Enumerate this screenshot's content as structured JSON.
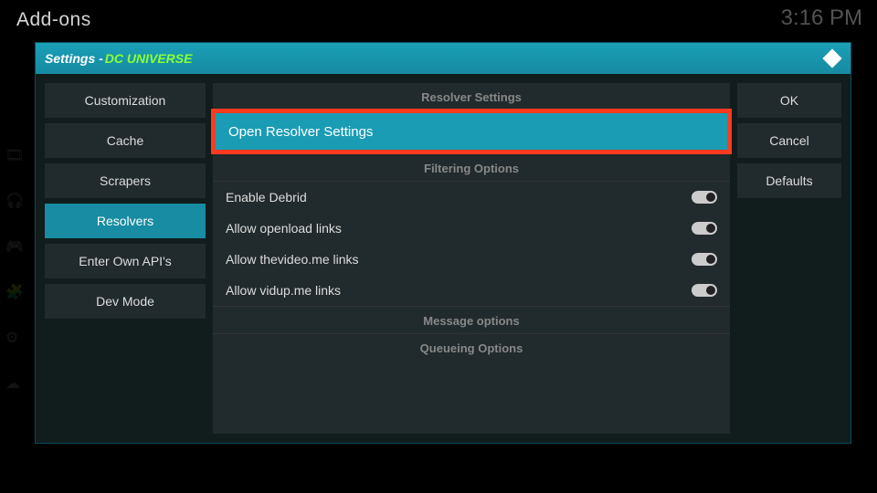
{
  "topbar": {
    "title": "Add-ons",
    "clock": "3:16 PM"
  },
  "dialog": {
    "prefix": "Settings - ",
    "addon_name": "DC UNIVERSE"
  },
  "nav": {
    "items": [
      {
        "label": "Customization"
      },
      {
        "label": "Cache"
      },
      {
        "label": "Scrapers"
      },
      {
        "label": "Resolvers",
        "active": true
      },
      {
        "label": "Enter Own API's"
      },
      {
        "label": "Dev Mode"
      }
    ]
  },
  "sections": {
    "resolver_header": "Resolver Settings",
    "open_resolver": "Open Resolver Settings",
    "filtering_header": "Filtering Options",
    "toggles": [
      {
        "label": "Enable Debrid",
        "on": true
      },
      {
        "label": "Allow openload links",
        "on": true
      },
      {
        "label": "Allow thevideo.me links",
        "on": true
      },
      {
        "label": "Allow vidup.me links",
        "on": true
      }
    ],
    "message_header": "Message options",
    "queueing_header": "Queueing Options"
  },
  "buttons": {
    "ok": "OK",
    "cancel": "Cancel",
    "defaults": "Defaults"
  }
}
